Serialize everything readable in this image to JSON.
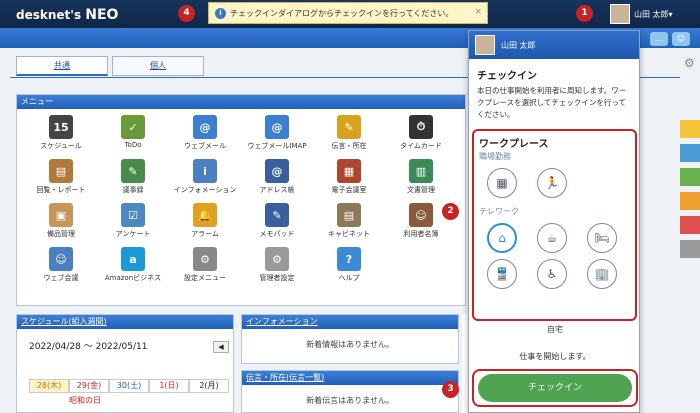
{
  "app": {
    "logo_main": "desknet's",
    "logo_neo": "NEO"
  },
  "top_user": {
    "name": "山田 太郎▾"
  },
  "toast": {
    "message": "チェックインダイアログからチェックインを行ってください。",
    "close": "×"
  },
  "badges": {
    "b1": "1",
    "b2": "2",
    "b3": "3",
    "b4": "4"
  },
  "tabs": [
    {
      "label": "共通"
    },
    {
      "label": "個人"
    }
  ],
  "menu": {
    "title": "メニュー",
    "items": [
      {
        "label": "スケジュール",
        "icon": "calendar-icon",
        "glyph": "15",
        "color": "#444444"
      },
      {
        "label": "ToDo",
        "icon": "todo-icon",
        "glyph": "✓",
        "color": "#6a9a3a"
      },
      {
        "label": "ウェブメール",
        "icon": "mail-icon",
        "glyph": "@",
        "color": "#3a7fd0"
      },
      {
        "label": "ウェブメールIMAP",
        "icon": "mail-imap-icon",
        "glyph": "@",
        "color": "#3a7fd0"
      },
      {
        "label": "伝言・所在",
        "icon": "memo-icon",
        "glyph": "✎",
        "color": "#d9a21e"
      },
      {
        "label": "タイムカード",
        "icon": "timecard-icon",
        "glyph": "⏱",
        "color": "#333333"
      },
      {
        "label": "",
        "icon": "blank",
        "glyph": "",
        "color": "#ffffff"
      },
      {
        "label": "回覧・レポート",
        "icon": "report-icon",
        "glyph": "▤",
        "color": "#b07a3a"
      },
      {
        "label": "議事録",
        "icon": "minutes-icon",
        "glyph": "✎",
        "color": "#4a8a4a"
      },
      {
        "label": "インフォメーション",
        "icon": "info-icon",
        "glyph": "i",
        "color": "#4a7fc0"
      },
      {
        "label": "アドレス帳",
        "icon": "address-book-icon",
        "glyph": "@",
        "color": "#3a5fa0"
      },
      {
        "label": "電子会議室",
        "icon": "meeting-room-icon",
        "glyph": "▦",
        "color": "#b0452f"
      },
      {
        "label": "文書管理",
        "icon": "document-icon",
        "glyph": "▥",
        "color": "#3a8a5a"
      },
      {
        "label": "",
        "icon": "blank",
        "glyph": "",
        "color": "#ffffff"
      },
      {
        "label": "備品管理",
        "icon": "equipment-icon",
        "glyph": "▣",
        "color": "#c8955a"
      },
      {
        "label": "アンケート",
        "icon": "survey-icon",
        "glyph": "☑",
        "color": "#4a8ac0"
      },
      {
        "label": "アラーム",
        "icon": "alarm-icon",
        "glyph": "🔔",
        "color": "#e0a020"
      },
      {
        "label": "メモパッド",
        "icon": "memopad-icon",
        "glyph": "✎",
        "color": "#3a5fa0"
      },
      {
        "label": "キャビネット",
        "icon": "cabinet-icon",
        "glyph": "▤",
        "color": "#8a7a5a"
      },
      {
        "label": "利用者名簿",
        "icon": "user-directory-icon",
        "glyph": "☺",
        "color": "#8a5a3a"
      },
      {
        "label": "",
        "icon": "blank",
        "glyph": "",
        "color": "#ffffff"
      },
      {
        "label": "ウェブ会議",
        "icon": "web-conference-icon",
        "glyph": "☺",
        "color": "#4a7fc0"
      },
      {
        "label": "Amazonビジネス",
        "icon": "amazon-icon",
        "glyph": "a",
        "color": "#1a9ad6"
      },
      {
        "label": "設定メニュー",
        "icon": "settings-icon",
        "glyph": "⚙",
        "color": "#888888"
      },
      {
        "label": "管理者設定",
        "icon": "admin-settings-icon",
        "glyph": "⚙",
        "color": "#999999"
      },
      {
        "label": "ヘルプ",
        "icon": "help-icon",
        "glyph": "?",
        "color": "#3a8ad6"
      }
    ]
  },
  "schedule": {
    "title": "スケジュール(組入週間)",
    "range": "2022/04/28 ～ 2022/05/11",
    "days": [
      "28(木)",
      "29(金)",
      "30(土)",
      "1(日)",
      "2(月)"
    ],
    "entry": "昭和の日",
    "nav_prev": "◀"
  },
  "information": {
    "title": "インフォメーション",
    "empty": "新着情報はありません。"
  },
  "memo": {
    "title": "伝言・所在(伝言一覧)",
    "empty": "新着伝言はありません。"
  },
  "popup": {
    "user_name": "山田 太郎",
    "title": "チェックイン",
    "description": "本日の仕事開始を利用者に周知します。ワークプレースを選択してチェックインを行ってください。",
    "workplace_title": "ワークプレース",
    "office_label": "職場勤務",
    "telework_label": "テレワーク",
    "office_options": [
      {
        "icon": "building-icon",
        "glyph": "▦"
      },
      {
        "icon": "running-icon",
        "glyph": "🏃"
      }
    ],
    "telework_row1": [
      {
        "icon": "home-icon",
        "glyph": "⌂",
        "selected": true
      },
      {
        "icon": "cafe-icon",
        "glyph": "☕"
      },
      {
        "icon": "hotel-icon",
        "glyph": "🛏"
      }
    ],
    "telework_row2": [
      {
        "icon": "transit-icon",
        "glyph": "🚆"
      },
      {
        "icon": "wheelchair-icon",
        "glyph": "♿"
      },
      {
        "icon": "satellite-office-icon",
        "glyph": "🏢"
      }
    ],
    "selected_label": "自宅",
    "start_message": "仕事を開始します。",
    "checkin_button": "チェックイン"
  },
  "colors": {
    "accent": "#2d6bc4",
    "highlight": "#c92222",
    "checkin": "#4fa24f"
  }
}
